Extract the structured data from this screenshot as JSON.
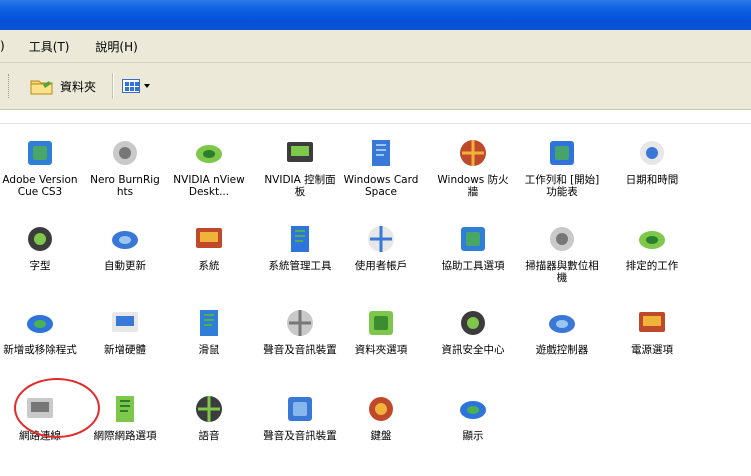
{
  "menubar": {
    "fragment": ")",
    "tools": "工具(T)",
    "help": "說明(H)"
  },
  "toolbar": {
    "folders_label": "資料夾"
  },
  "icons": {
    "row1": [
      "Adobe Version Cue CS3",
      "Nero BurnRights",
      "NVIDIA nView Deskt...",
      "NVIDIA 控制面板",
      "Windows CardSpace",
      "Windows 防火牆",
      "工作列和 [開始] 功能表",
      "日期和時間"
    ],
    "row2": [
      "字型",
      "自動更新",
      "系統",
      "系統管理工具",
      "使用者帳戶",
      "協助工具選項",
      "掃描器與數位相機",
      "排定的工作"
    ],
    "row3": [
      "新增或移除程式",
      "新增硬體",
      "滑鼠",
      "聲音及音訊裝置",
      "資料夾選項",
      "資訊安全中心",
      "遊戲控制器",
      "電源選項"
    ],
    "row4": [
      "網路連線",
      "網際網路選項",
      "語音",
      "聲音及音訊裝置",
      "鍵盤",
      "顯示"
    ]
  },
  "icon_names": {
    "row1": [
      "adobe-version-cue-icon",
      "nero-burnrights-icon",
      "nvidia-nview-icon",
      "nvidia-control-panel-icon",
      "cardspace-icon",
      "firewall-icon",
      "taskbar-start-menu-icon",
      "date-time-icon"
    ],
    "row2": [
      "fonts-icon",
      "automatic-updates-icon",
      "system-icon",
      "admin-tools-icon",
      "user-accounts-icon",
      "accessibility-icon",
      "scanner-camera-icon",
      "scheduled-tasks-icon"
    ],
    "row3": [
      "add-remove-programs-icon",
      "add-hardware-icon",
      "mouse-icon",
      "sounds-audio-icon",
      "folder-options-icon",
      "security-center-icon",
      "game-controllers-icon",
      "power-options-icon"
    ],
    "row4": [
      "network-connections-icon",
      "internet-options-icon",
      "speech-icon",
      "sounds-audio-devices-icon",
      "keyboard-icon",
      "display-icon"
    ]
  },
  "colors": {
    "titlebar": "#0a5ce0",
    "highlight_circle": "#e32b2b"
  }
}
